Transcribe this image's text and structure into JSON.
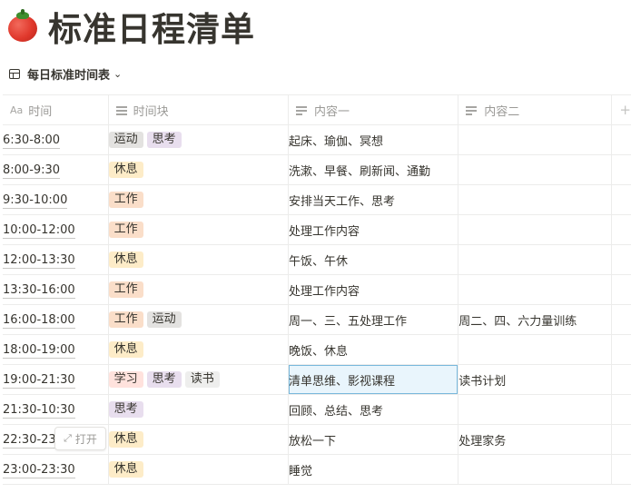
{
  "page": {
    "title": "标准日程清单",
    "icon": "tomato-icon"
  },
  "view": {
    "icon": "table-icon",
    "label": "每日标准时间表",
    "chevron": "⌄"
  },
  "columns": {
    "time": {
      "label": "时间",
      "icon": "Aa"
    },
    "block": {
      "label": "时间块",
      "icon": "list-icon"
    },
    "c1": {
      "label": "内容一",
      "icon": "text-lines-icon"
    },
    "c2": {
      "label": "内容二",
      "icon": "text-lines-icon"
    },
    "add": "+"
  },
  "tag_colors": {
    "运动": "#e3e2e0",
    "思考": "#e8deee",
    "休息": "#fdecc8",
    "工作": "#fadec9",
    "学习": "#ffe2dd",
    "读书": "#eeeeed"
  },
  "rows": [
    {
      "time": "6:30-8:00",
      "tags": [
        "运动",
        "思考"
      ],
      "c1": "起床、瑜伽、冥想",
      "c2": ""
    },
    {
      "time": "8:00-9:30",
      "tags": [
        "休息"
      ],
      "c1": "洗漱、早餐、刷新闻、通勤",
      "c2": ""
    },
    {
      "time": "9:30-10:00",
      "tags": [
        "工作"
      ],
      "c1": "安排当天工作、思考",
      "c2": ""
    },
    {
      "time": "10:00-12:00",
      "tags": [
        "工作"
      ],
      "c1": "处理工作内容",
      "c2": ""
    },
    {
      "time": "12:00-13:30",
      "tags": [
        "休息"
      ],
      "c1": "午饭、午休",
      "c2": ""
    },
    {
      "time": "13:30-16:00",
      "tags": [
        "工作"
      ],
      "c1": "处理工作内容",
      "c2": ""
    },
    {
      "time": "16:00-18:00",
      "tags": [
        "工作",
        "运动"
      ],
      "c1": "周一、三、五处理工作",
      "c2": "周二、四、六力量训练"
    },
    {
      "time": "18:00-19:00",
      "tags": [
        "休息"
      ],
      "c1": "晚饭、休息",
      "c2": ""
    },
    {
      "time": "19:00-21:30",
      "tags": [
        "学习",
        "思考",
        "读书"
      ],
      "c1": "清单思维、影视课程",
      "c2": "读书计划",
      "selected": "c1"
    },
    {
      "time": "21:30-10:30",
      "tags": [
        "思考"
      ],
      "c1": "回顾、总结、思考",
      "c2": ""
    },
    {
      "time": "22:30-23:00",
      "tags": [
        "休息"
      ],
      "c1": "放松一下",
      "c2": "处理家务"
    },
    {
      "time": "23:00-23:30",
      "tags": [
        "休息"
      ],
      "c1": "睡觉",
      "c2": ""
    }
  ],
  "open_button": {
    "label": "打开",
    "icon": "expand-icon"
  }
}
